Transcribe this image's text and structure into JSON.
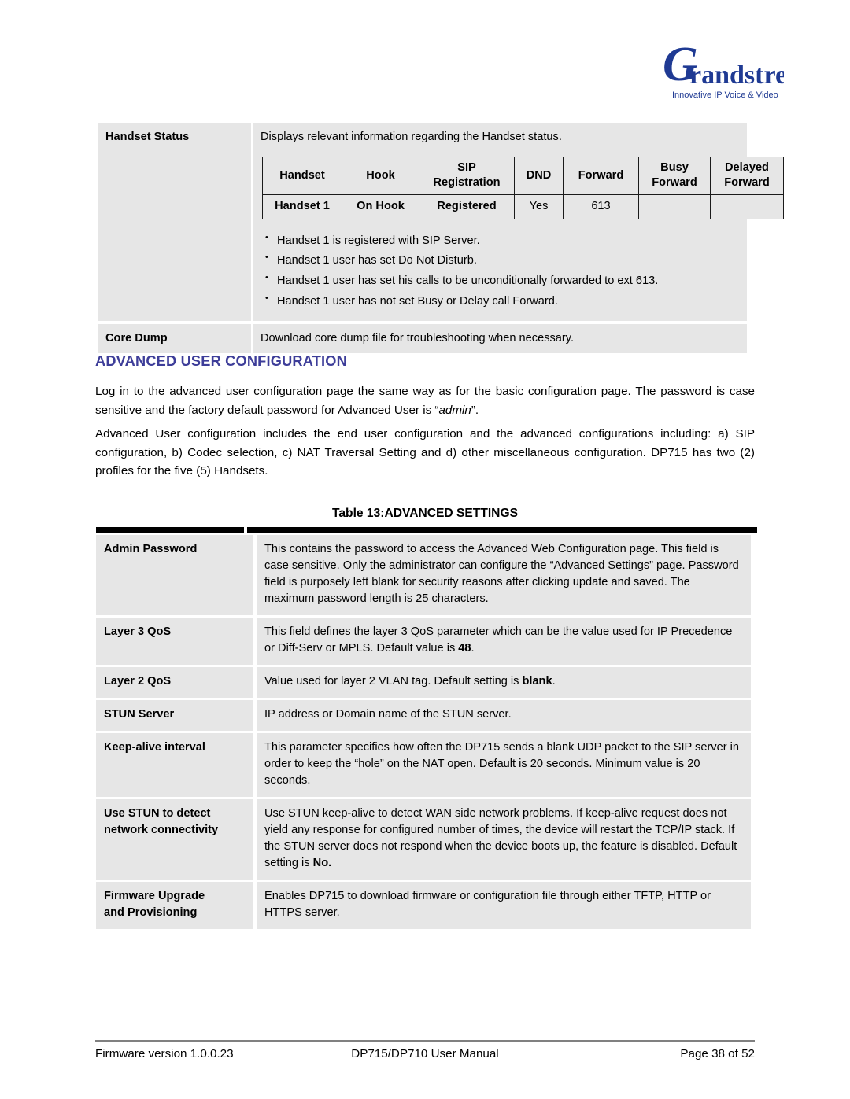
{
  "brand": {
    "logo_name": "Grandstream",
    "logo_wordmark": "randstream",
    "logo_tagline": "Innovative IP Voice & Video",
    "logo_color": "#1f3a93"
  },
  "status_table": {
    "rows": [
      {
        "key": "Handset Status",
        "lead": "Displays relevant information regarding the Handset status.",
        "grid": {
          "headers": [
            "Handset",
            "Hook",
            "SIP Registration",
            "DND",
            "Forward",
            "Busy Forward",
            "Delayed Forward"
          ],
          "header_lines": [
            [
              "Handset"
            ],
            [
              "Hook"
            ],
            [
              "SIP",
              "Registration"
            ],
            [
              "DND"
            ],
            [
              "Forward"
            ],
            [
              "Busy",
              "Forward"
            ],
            [
              "Delayed",
              "Forward"
            ]
          ],
          "row": [
            "Handset 1",
            "On Hook",
            "Registered",
            "Yes",
            "613",
            "",
            ""
          ]
        },
        "bullets": [
          "Handset 1 is registered with SIP Server.",
          "Handset 1 user has set Do Not Disturb.",
          "Handset 1 user has set his calls to be unconditionally forwarded to ext 613.",
          "Handset 1 user has not set Busy or Delay call Forward."
        ]
      },
      {
        "key": "Core Dump",
        "desc": "Download core dump file for troubleshooting when necessary."
      }
    ]
  },
  "section": {
    "heading": "ADVANCED USER CONFIGURATION",
    "heading_color": "#3d3d99",
    "paragraph_1_a": "Log in to the advanced user configuration page the same way as for the basic configuration page. The password is case sensitive and the factory default password for Advanced User is “",
    "paragraph_1_em": "admin",
    "paragraph_1_b": "”.",
    "paragraph_2": "Advanced User configuration includes the end user configuration and the advanced configurations including:  a) SIP configuration, b) Codec selection, c) NAT Traversal Setting and d) other miscellaneous configuration. DP715 has two (2) profiles for the five (5) Handsets."
  },
  "settings_table": {
    "caption": "Table 13:ADVANCED SETTINGS",
    "rows": [
      {
        "key": "Admin Password",
        "desc": "This contains the password to access the Advanced Web Configuration page. This field is case sensitive. Only the administrator can configure the “Advanced Settings” page. Password field is purposely left blank for security reasons after clicking update and saved. The maximum password length is 25 characters."
      },
      {
        "key": "Layer 3 QoS",
        "desc_a": "This field defines the layer 3 QoS parameter which can be the value used for IP Precedence or Diff-Serv or MPLS.  Default value is ",
        "desc_bold": "48",
        "desc_b": "."
      },
      {
        "key": "Layer 2 QoS",
        "desc_a": "Value used for layer 2 VLAN tag.  Default setting is ",
        "desc_bold": "blank",
        "desc_b": "."
      },
      {
        "key": "STUN Server",
        "desc": "IP address or Domain name of the STUN server."
      },
      {
        "key": "Keep-alive interval",
        "desc": "This parameter specifies how often the DP715  sends a blank UDP packet to the SIP server in order to keep the “hole” on the NAT open.  Default is 20 seconds. Minimum value is 20 seconds."
      },
      {
        "key": "Use STUN to detect network connectivity",
        "key_line_1": "Use STUN to detect",
        "key_line_2": "network connectivity",
        "desc_a": "Use STUN keep-alive to detect WAN side network problems. If keep-alive request does not yield any response for configured number of times, the device will restart the TCP/IP stack. If the STUN server does not respond when the device boots up, the feature is disabled. Default setting is ",
        "desc_bold": "No.",
        "desc_b": ""
      },
      {
        "key": "Firmware Upgrade and Provisioning",
        "key_line_1": "Firmware Upgrade",
        "key_line_2": "and Provisioning",
        "desc": "Enables DP715 to download firmware or configuration file through either TFTP, HTTP or HTTPS server."
      }
    ]
  },
  "footer": {
    "firmware": "Firmware version 1.0.0.23",
    "manual": "DP715/DP710 User Manual",
    "page": "Page 38 of 52"
  }
}
